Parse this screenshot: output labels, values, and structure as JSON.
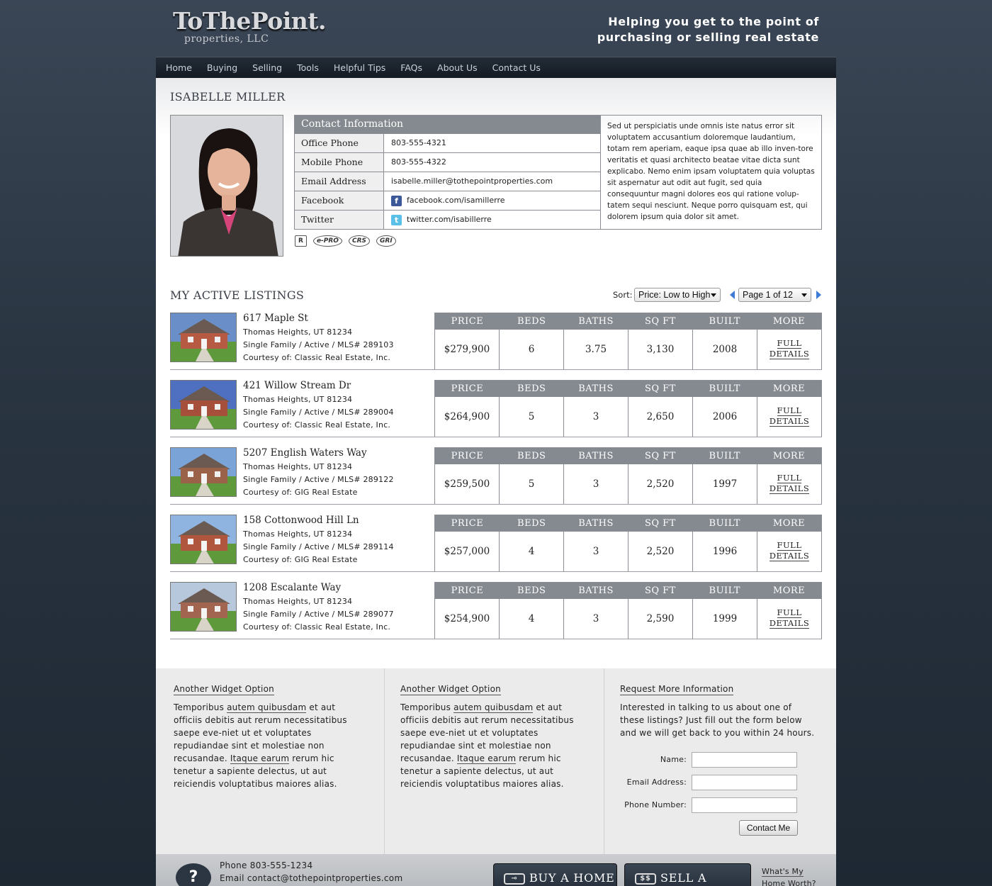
{
  "header": {
    "logo_main": "ToThePoint.",
    "logo_sub": "properties, LLC",
    "tagline_1": "Helping you get to the point of",
    "tagline_2": "purchasing or selling real estate"
  },
  "nav": [
    "Home",
    "Buying",
    "Selling",
    "Tools",
    "Helpful Tips",
    "FAQs",
    "About Us",
    "Contact Us"
  ],
  "agent": {
    "name": "ISABELLE MILLER",
    "contact_title": "Contact Information",
    "rows": [
      {
        "label": "Office Phone",
        "value": "803-555-4321"
      },
      {
        "label": "Mobile Phone",
        "value": "803-555-4322"
      },
      {
        "label": "Email Address",
        "value": "isabelle.miller@tothepointproperties.com"
      },
      {
        "label": "Facebook",
        "value": "facebook.com/isamillerre"
      },
      {
        "label": "Twitter",
        "value": "twitter.com/isabillerre"
      }
    ],
    "bio": "Sed ut perspiciatis unde omnis iste natus error sit voluptatem accusantium doloremque laudantium, totam rem aperiam, eaque ipsa quae ab illo inven-tore veritatis et quasi architecto beatae vitae dicta sunt explicabo. Nemo enim ipsam voluptatem quia voluptas sit aspernatur aut odit aut fugit, sed quia consequuntur magni dolores eos qui ratione volup-tatem sequi nesciunt. Neque porro quisquam est, qui dolorem ipsum quia dolor sit amet.",
    "badges": [
      "R",
      "e-PRO",
      "CRS",
      "GRI"
    ]
  },
  "listings_section": {
    "title": "MY ACTIVE LISTINGS",
    "sort_label": "Sort:",
    "sort_value": "Price: Low to High",
    "page_value": "Page 1 of 12",
    "headers": [
      "PRICE",
      "BEDS",
      "BATHS",
      "SQ FT",
      "BUILT",
      "MORE"
    ],
    "more_1": "FULL",
    "more_2": "DETAILS"
  },
  "listings": [
    {
      "address": "617 Maple St",
      "city": "Thomas Heights, UT 81234",
      "type": "Single Family / Active / MLS# 289103",
      "courtesy": "Courtesy of: Classic Real Estate, Inc.",
      "price": "$279,900",
      "beds": "6",
      "baths": "3.75",
      "sqft": "3,130",
      "built": "2008"
    },
    {
      "address": "421 Willow Stream Dr",
      "city": "Thomas Heights, UT 81234",
      "type": "Single Family / Active / MLS# 289004",
      "courtesy": "Courtesy of: Classic Real Estate, Inc.",
      "price": "$264,900",
      "beds": "5",
      "baths": "3",
      "sqft": "2,650",
      "built": "2006"
    },
    {
      "address": "5207 English Waters Way",
      "city": "Thomas Heights, UT 81234",
      "type": "Single Family / Active / MLS# 289122",
      "courtesy": "Courtesy of: GIG Real Estate",
      "price": "$259,500",
      "beds": "5",
      "baths": "3",
      "sqft": "2,520",
      "built": "1997"
    },
    {
      "address": "158 Cottonwood Hill Ln",
      "city": "Thomas Heights, UT 81234",
      "type": "Single Family / Active / MLS# 289114",
      "courtesy": "Courtesy of: GIG Real Estate",
      "price": "$257,000",
      "beds": "4",
      "baths": "3",
      "sqft": "2,520",
      "built": "1996"
    },
    {
      "address": "1208 Escalante Way",
      "city": "Thomas Heights, UT 81234",
      "type": "Single Family / Active / MLS# 289077",
      "courtesy": "Courtesy of: Classic Real Estate, Inc.",
      "price": "$254,900",
      "beds": "4",
      "baths": "3",
      "sqft": "2,590",
      "built": "1999"
    }
  ],
  "widgets": {
    "w1": {
      "title": "Another Widget Option",
      "t1": "Temporibus ",
      "link1": "autem quibusdam",
      "t2": " et aut officiis debitis aut rerum necessitatibus saepe eve-niet ut et voluptates repudiandae sint et molestiae non recusandae. ",
      "link2": "Itaque earum",
      "t3": " rerum hic tenetur a sapiente delectus, ut aut reiciendis voluptatibus maiores alias."
    },
    "w2": {
      "title": "Another Widget Option",
      "t1": "Temporibus ",
      "link1": "autem quibusdam",
      "t2": " et aut officiis debitis aut rerum necessitatibus saepe eve-niet ut et voluptates repudiandae sint et molestiae non recusandae. ",
      "link2": "Itaque earum",
      "t3": " rerum hic tenetur a sapiente delectus, ut aut reiciendis voluptatibus maiores alias."
    },
    "w3": {
      "title": "Request More Information",
      "text": "Interested in talking to us about one of these listings? Just fill out the form below and we will get back to you within 24 hours.",
      "name_label": "Name:",
      "email_label": "Email Address:",
      "phone_label": "Phone Number:",
      "button": "Contact Me"
    }
  },
  "footer": {
    "q": "?",
    "phone": "Phone 803-555-1234",
    "email": "Email contact@tothepointproperties.com",
    "buy": "BUY A HOME",
    "sell": "SELL A HOME",
    "sell_icon": "$$",
    "worth_1": "What's My",
    "worth_2": "Home Worth?"
  }
}
